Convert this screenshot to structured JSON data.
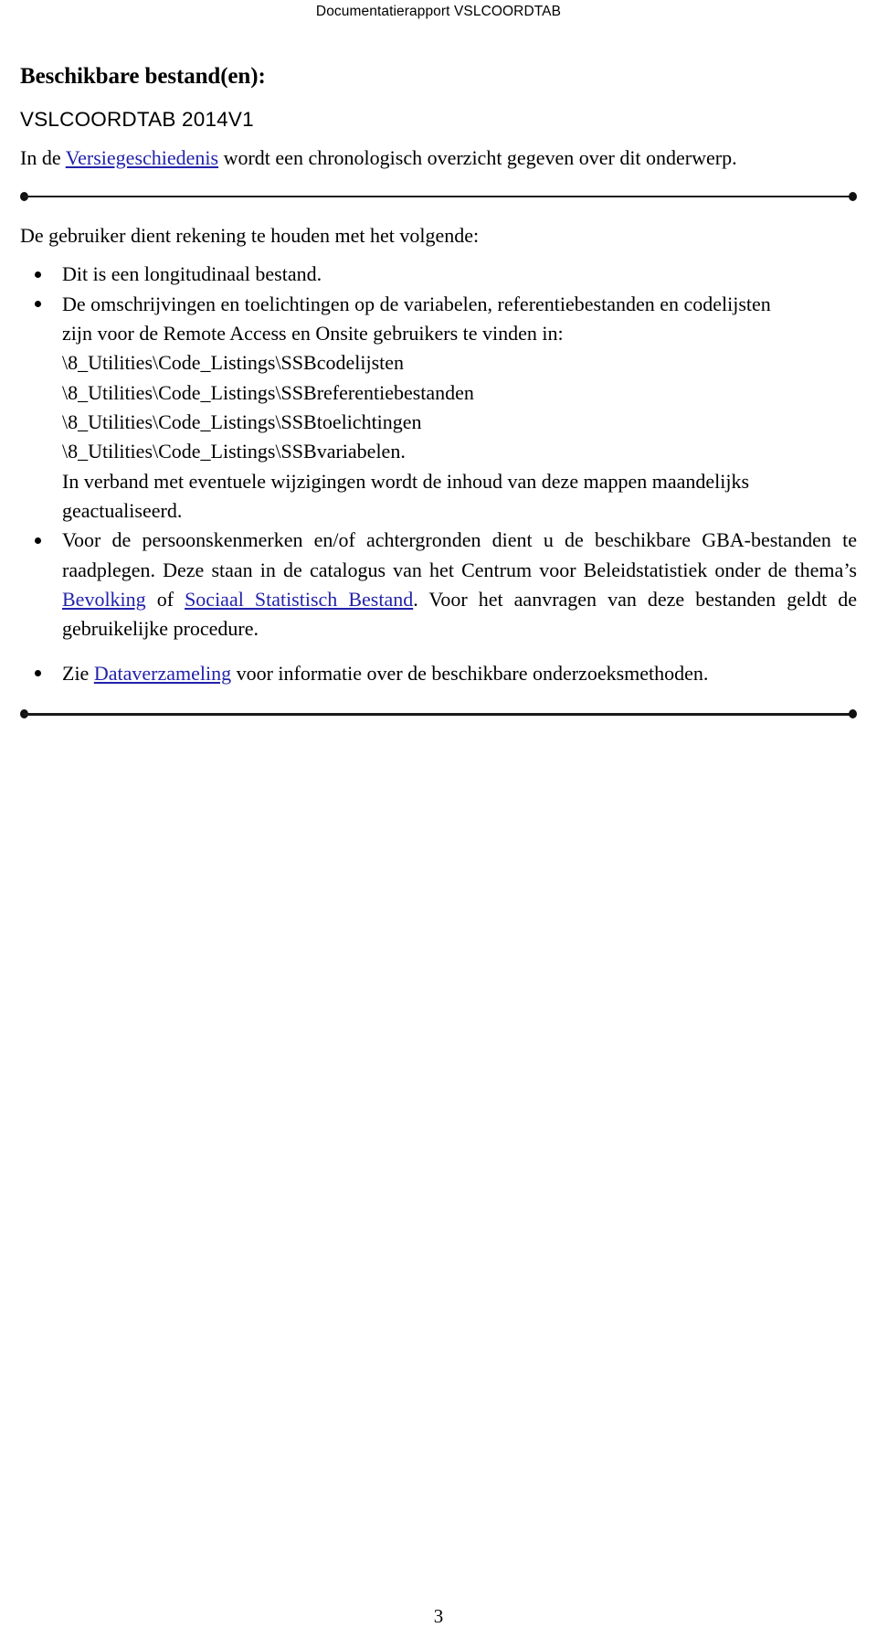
{
  "header": {
    "running_title": "Documentatierapport VSLCOORDTAB"
  },
  "section": {
    "title": "Beschikbare bestand(en):",
    "filename": "VSLCOORDTAB 2014V1"
  },
  "version_history": {
    "text_before": "In de ",
    "link_label": "Versiegeschiedenis",
    "text_after": " wordt een chronologisch overzicht gegeven over dit onderwerp."
  },
  "notice": {
    "lead": "De gebruiker dient rekening te houden met het volgende:",
    "bullets": [
      {
        "id": "longitudinaal",
        "text": "Dit is een longitudinaal bestand."
      },
      {
        "id": "omschrijvingen",
        "line1": "De omschrijvingen en toelichtingen op de variabelen, referentiebestanden en codelijsten",
        "line2": "zijn voor de Remote Access en Onsite gebruikers te vinden in:",
        "paths": [
          "\\8_Utilities\\Code_Listings\\SSBcodelijsten",
          "\\8_Utilities\\Code_Listings\\SSBreferentiebestanden",
          "\\8_Utilities\\Code_Listings\\SSBtoelichtingen",
          "\\8_Utilities\\Code_Listings\\SSBvariabelen."
        ],
        "line3": "In verband met eventuele wijzigingen wordt de inhoud van deze mappen maandelijks",
        "line4": "geactualiseerd."
      },
      {
        "id": "persoonskenmerken",
        "part1": "Voor de persoonskenmerken en/of achtergronden dient u de beschikbare GBA-bestanden te raadplegen. Deze staan in de catalogus van het Centrum voor Beleidstatistiek onder de thema’s ",
        "link1": "Bevolking",
        "between": " of ",
        "link2": "Sociaal Statistisch Bestand",
        "part2": ". Voor het aanvragen van deze bestanden geldt de gebruikelijke procedure."
      },
      {
        "id": "dataverzameling",
        "part1": "Zie ",
        "link1": "Dataverzameling",
        "part2": " voor informatie over de beschikbare onderzoeksmethoden."
      }
    ]
  },
  "footer": {
    "page_number": "3"
  },
  "colors": {
    "link": "#2222aa",
    "text": "#000000",
    "rule": "#1a1a1a",
    "background": "#ffffff"
  }
}
